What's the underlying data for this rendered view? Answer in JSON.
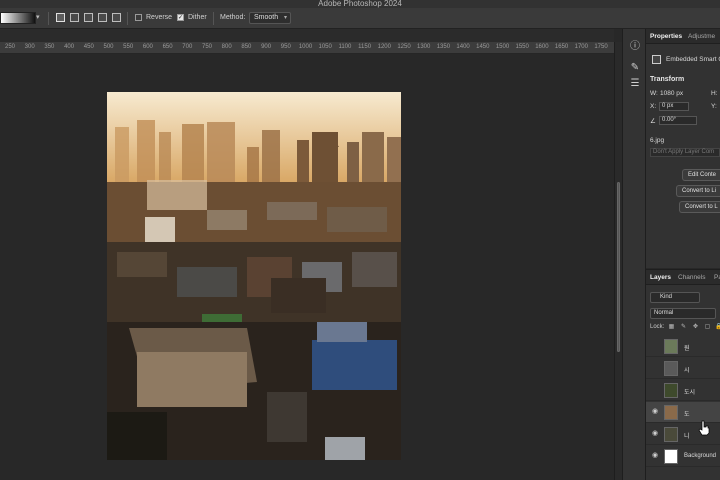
{
  "app": {
    "title": "Adobe Photoshop 2024"
  },
  "options_bar": {
    "reverse_label": "Reverse",
    "reverse_checked": false,
    "dither_label": "Dither",
    "dither_checked": true,
    "method_label": "Method:",
    "method_value": "Smooth",
    "gradient_colors": [
      "#ffffff",
      "#111111"
    ]
  },
  "ruler": {
    "ticks": [
      "250",
      "300",
      "350",
      "400",
      "450",
      "500",
      "550",
      "600",
      "650",
      "700",
      "750",
      "800",
      "850",
      "900",
      "950",
      "1000",
      "1050",
      "1100",
      "1150",
      "1200",
      "1250",
      "1300",
      "1350",
      "1400",
      "1450",
      "1500",
      "1550",
      "1600",
      "1650",
      "1700",
      "1750",
      "1800"
    ]
  },
  "tools": [
    "info-icon",
    "brush-settings-icon",
    "adjustments-icon"
  ],
  "properties": {
    "tabs": [
      "Properties",
      "Adjustme"
    ],
    "layer_type": "Embedded Smart O",
    "transform_heading": "Transform",
    "w_label": "W:",
    "w_value": "1080 px",
    "h_label": "H:",
    "x_label": "X:",
    "x_value": "0 px",
    "y_label": "Y:",
    "angle_value": "0.00°",
    "file_name": "6.jpg",
    "comps_placeholder": "Don't Apply Layer Com",
    "buttons": [
      "Edit Conte",
      "Convert to Li",
      "Convert to L"
    ]
  },
  "layers_panel": {
    "tabs": [
      "Layers",
      "Channels",
      "Pa"
    ],
    "kind_label": "Kind",
    "blend_mode": "Normal",
    "lock_label": "Lock:",
    "layers": [
      {
        "name": "원",
        "visible": false,
        "selected": false,
        "thumb": "#6b7a5a"
      },
      {
        "name": "시",
        "visible": false,
        "selected": false,
        "thumb": "#5a5a5a"
      },
      {
        "name": "도시",
        "visible": false,
        "selected": false,
        "thumb": "#3e4a2c"
      },
      {
        "name": "도",
        "visible": true,
        "selected": true,
        "thumb": "#8a6a4a"
      },
      {
        "name": "니",
        "visible": true,
        "selected": false,
        "thumb": "#4a4a3a"
      },
      {
        "name": "Background",
        "visible": true,
        "selected": false,
        "thumb": "#ffffff"
      }
    ]
  },
  "colors": {
    "accent": "#e6e6e6",
    "panel_bg": "#323232",
    "canvas_bg": "#282828"
  }
}
